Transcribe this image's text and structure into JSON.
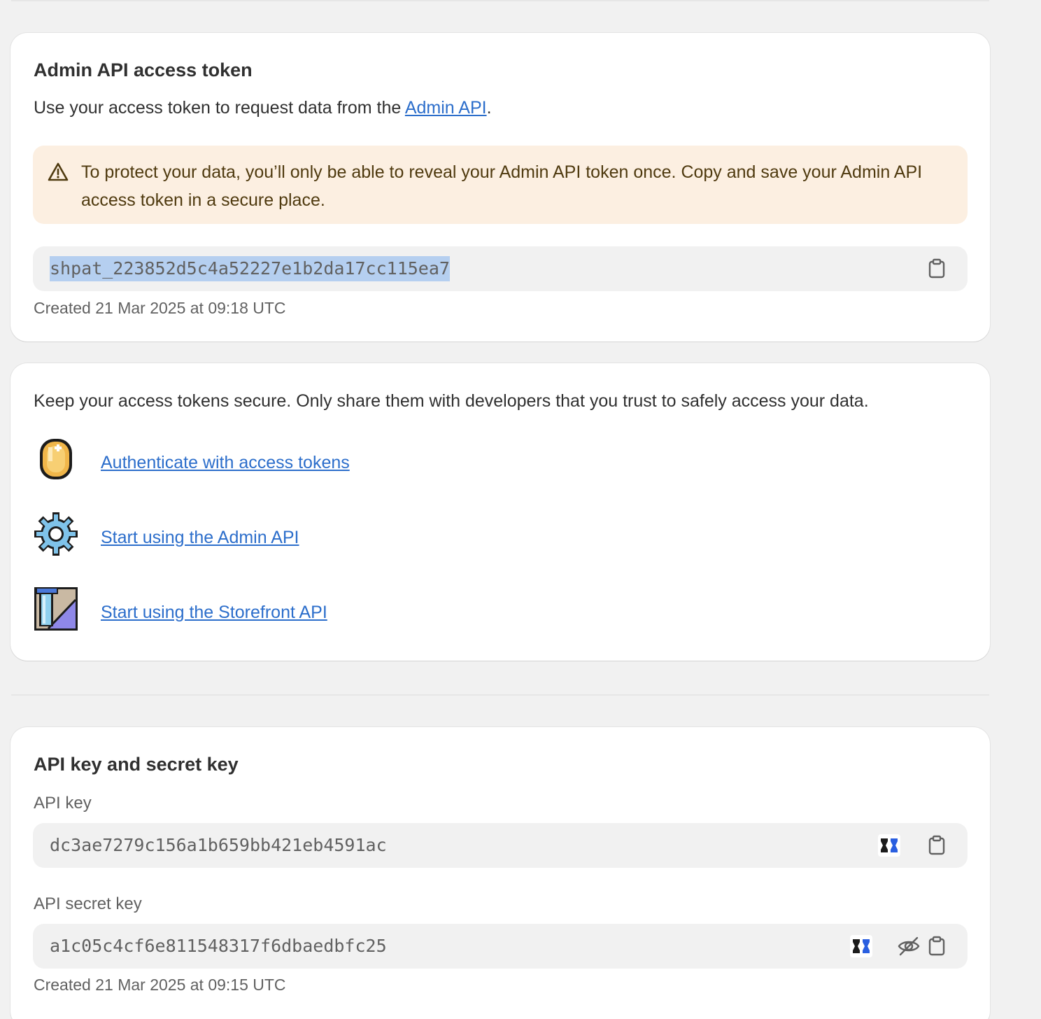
{
  "token_card": {
    "title": "Admin API access token",
    "description_prefix": "Use your access token to request data from the ",
    "description_link": "Admin API",
    "description_suffix": ".",
    "warning": "To protect your data, you’ll only be able to reveal your Admin API token once. Copy and save your Admin API access token in a secure place.",
    "token_value": "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",
    "created": "Created 21 Mar 2025 at 09:18 UTC"
  },
  "resources_card": {
    "description": "Keep your access tokens secure. Only share them with developers that you trust to safely access your data.",
    "links": [
      {
        "label": "Authenticate with access tokens",
        "icon": "coin-icon"
      },
      {
        "label": "Start using the Admin API",
        "icon": "gear-icon"
      },
      {
        "label": "Start using the Storefront API",
        "icon": "storefront-pillar-icon"
      }
    ]
  },
  "keys_card": {
    "title": "API key and secret key",
    "api_key_label": "API key",
    "api_key_value": "dc3ae7279c156a1b659bb421eb4591ac",
    "secret_key_label": "API secret key",
    "secret_key_value": "a1c05c4cf6e811548317f6dbaedbfc25",
    "created": "Created 21 Mar 2025 at 09:15 UTC"
  },
  "colors": {
    "link": "#2c6ecb",
    "warning_bg": "#fcefe1",
    "selection": "#b5cff0"
  }
}
